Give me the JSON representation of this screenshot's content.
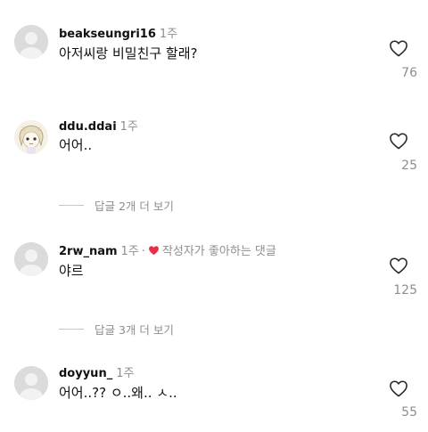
{
  "comments": [
    {
      "username": "beakseungri16",
      "time": "1주",
      "text": "아저씨랑 비밀친구 할래?",
      "likes": "76",
      "avatar": "default-avatar"
    },
    {
      "username": "ddu.ddai",
      "time": "1주",
      "text": "어어..",
      "likes": "25",
      "avatar": "anime-character-avatar",
      "replies_label": "답글 2개 더 보기"
    },
    {
      "username": "2rw_nam",
      "time": "1주",
      "dot": "·",
      "liked_by_author": "작성자가 좋아하는 댓글",
      "text": "야르",
      "likes": "125",
      "avatar": "default-avatar",
      "replies_label": "답글 3개 더 보기"
    },
    {
      "username": "doyyun_",
      "time": "1주",
      "text": "어어..?? ㅇ..왜.. ㅅ..",
      "likes": "55",
      "avatar": "default-avatar"
    }
  ],
  "colors": {
    "heart_red": "#ed2b45",
    "muted": "#8e8e8e"
  }
}
